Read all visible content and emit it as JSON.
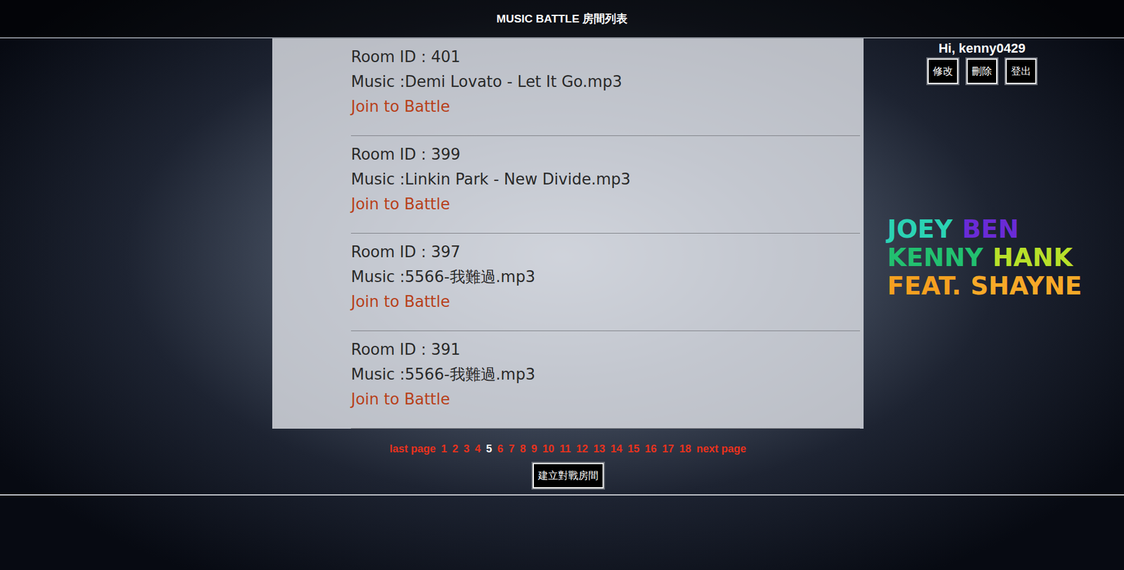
{
  "header": {
    "title": "MUSIC BATTLE 房間列表"
  },
  "user": {
    "greeting": "Hi, kenny0429",
    "buttons": [
      "修改",
      "刪除",
      "登出"
    ]
  },
  "rooms": [
    {
      "id_label": "Room ID : 401",
      "music": "Music :Demi Lovato - Let It Go.mp3",
      "action": "Join to Battle"
    },
    {
      "id_label": "Room ID : 399",
      "music": "Music :Linkin Park - New Divide.mp3",
      "action": "Join to Battle"
    },
    {
      "id_label": "Room ID : 397",
      "music": "Music :5566-我難過.mp3",
      "action": "Join to Battle"
    },
    {
      "id_label": "Room ID : 391",
      "music": "Music :5566-我難過.mp3",
      "action": "Join to Battle"
    }
  ],
  "pagination": {
    "prev": "last page",
    "pages": [
      {
        "label": "1",
        "selected": false
      },
      {
        "label": "2",
        "selected": false
      },
      {
        "label": "3",
        "selected": false
      },
      {
        "label": "4",
        "selected": false
      },
      {
        "label": "5",
        "selected": true
      },
      {
        "label": "6",
        "selected": false
      },
      {
        "label": "7",
        "selected": false
      },
      {
        "label": "8",
        "selected": false
      },
      {
        "label": "9",
        "selected": false
      },
      {
        "label": "10",
        "selected": false
      },
      {
        "label": "11",
        "selected": false
      },
      {
        "label": "12",
        "selected": false
      },
      {
        "label": "13",
        "selected": false
      },
      {
        "label": "14",
        "selected": false
      },
      {
        "label": "15",
        "selected": false
      },
      {
        "label": "16",
        "selected": false
      },
      {
        "label": "17",
        "selected": false
      },
      {
        "label": "18",
        "selected": false
      }
    ],
    "next": "next page"
  },
  "create_button": "建立對戰房間",
  "credits": [
    {
      "words": [
        {
          "text": "JOEY",
          "color": "#2bd3b4"
        },
        {
          "text": "BEN",
          "color": "#6a2bd6"
        }
      ]
    },
    {
      "words": [
        {
          "text": "KENNY",
          "color": "#22c070"
        },
        {
          "text": "HANK",
          "color": "#b8e02a"
        }
      ]
    },
    {
      "words": [
        {
          "text": "FEAT.",
          "color": "#f5a020"
        },
        {
          "text": "SHAYNE",
          "color": "#f7a928"
        }
      ]
    }
  ]
}
